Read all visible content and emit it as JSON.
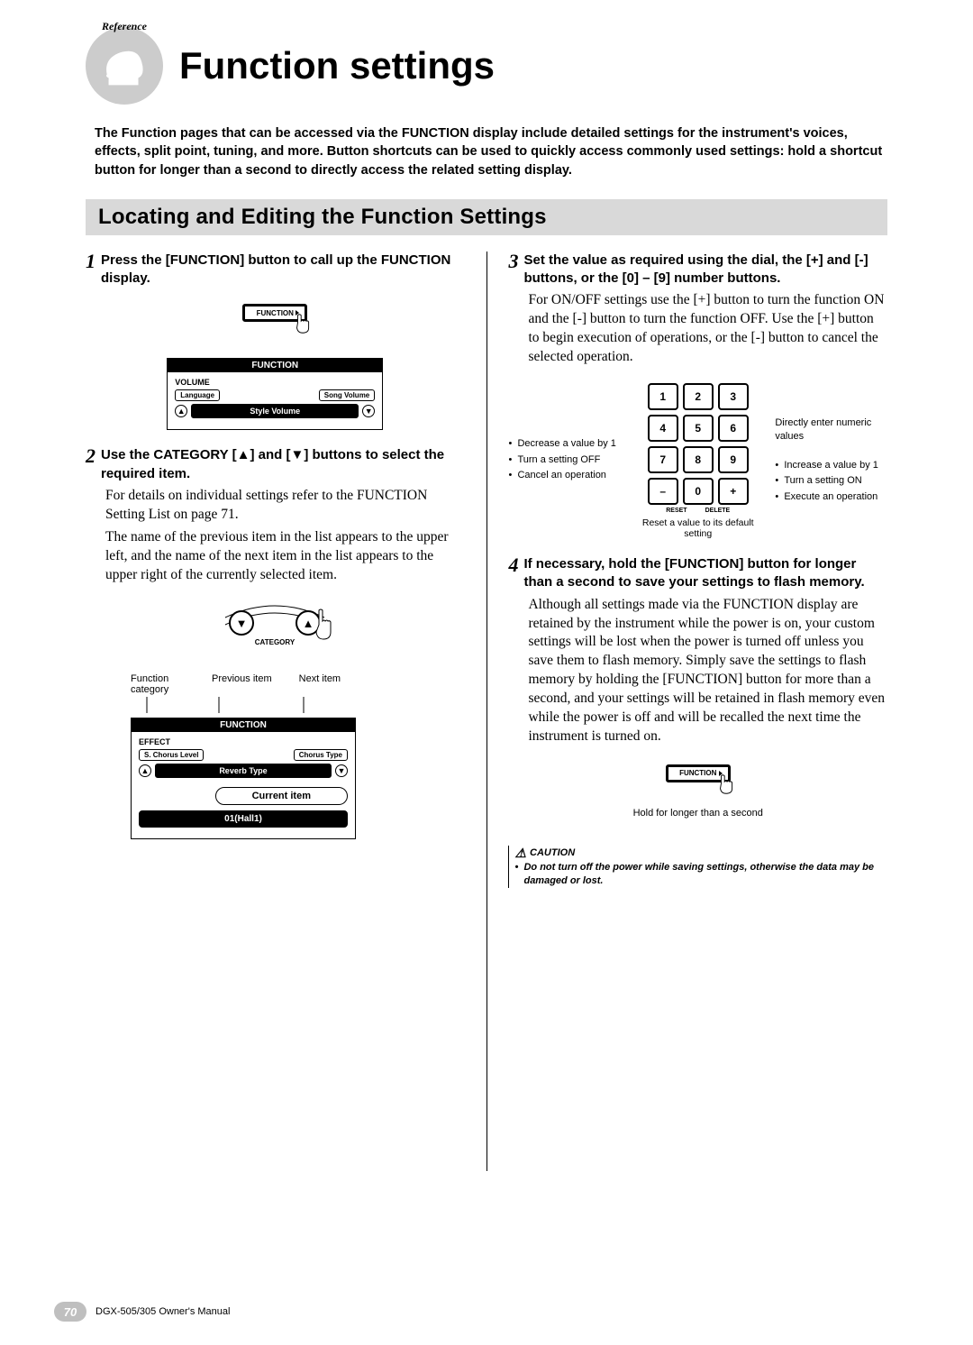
{
  "header": {
    "badge_text": "Reference",
    "title": "Function settings"
  },
  "intro": "The Function pages that can be accessed via the FUNCTION display include detailed settings for the instrument's voices, effects, split point, tuning, and more. Button shortcuts can be used to quickly access commonly used settings: hold a shortcut button for longer than a second to directly access the related setting display.",
  "section_bar": "Locating and Editing the Function Settings",
  "steps": {
    "s1": {
      "num": "1",
      "title": "Press the [FUNCTION] button to call up the FUNCTION display.",
      "func_button_label": "FUNCTION",
      "screen": {
        "title": "FUNCTION",
        "category": "VOLUME",
        "prev": "Language",
        "next": "Song Volume",
        "current": "Style Volume"
      }
    },
    "s2": {
      "num": "2",
      "title_prefix": "Use the CATEGORY [",
      "title_mid": "] and [",
      "title_suffix": "] buttons to select the required item.",
      "body1": "For details on individual settings refer to the FUNCTION Setting List on page 71.",
      "body2": "The name of the previous item in the list appears to the upper left, and the name of the next item in the list appears to the upper right of the currently selected item.",
      "category_label": "CATEGORY",
      "labels": {
        "func_cat": "Function category",
        "prev": "Previous item",
        "next": "Next item",
        "current": "Current item"
      },
      "screen": {
        "title": "FUNCTION",
        "category": "EFFECT",
        "prev": "S. Chorus Level",
        "next": "Chorus Type",
        "current": "Reverb Type",
        "value": "01(Hall1)"
      }
    },
    "s3": {
      "num": "3",
      "title": "Set the value as required using the dial, the [+] and [-] buttons, or the [0] – [9] number buttons.",
      "body": "For ON/OFF settings use the [+] button to turn the function ON and the [-] button to turn the function OFF. Use the [+] button to begin execution of operations, or the [-] button to cancel the selected operation.",
      "keypad": {
        "keys": [
          "1",
          "2",
          "3",
          "4",
          "5",
          "6",
          "7",
          "8",
          "9",
          "–",
          "0",
          "+"
        ],
        "left": [
          "Decrease a value by 1",
          "Turn a setting OFF",
          "Cancel an operation"
        ],
        "right_top": "Directly enter numeric values",
        "right": [
          "Increase a value by 1",
          "Turn a setting ON",
          "Execute an operation"
        ],
        "reset": "RESET",
        "delete": "DELETE",
        "reset_caption": "Reset a value to its default setting"
      }
    },
    "s4": {
      "num": "4",
      "title": "If necessary, hold the [FUNCTION] button for longer than a second to save your settings to flash memory.",
      "body": "Although all settings made via the FUNCTION display are retained by the instrument while the power is on, your custom settings will be lost when the power is turned off unless you save them to flash memory. Simply save the settings to flash memory by holding the [FUNCTION] button for more than a second, and your settings will be retained in flash memory even while the power is off and will be recalled the next time the instrument is turned on.",
      "func_button_label": "FUNCTION",
      "hold_note": "Hold for longer than a second"
    }
  },
  "caution": {
    "head": "CAUTION",
    "text": "Do not turn off the power while saving settings, otherwise the data may be damaged or lost."
  },
  "footer": {
    "page": "70",
    "text": "DGX-505/305  Owner's Manual"
  }
}
